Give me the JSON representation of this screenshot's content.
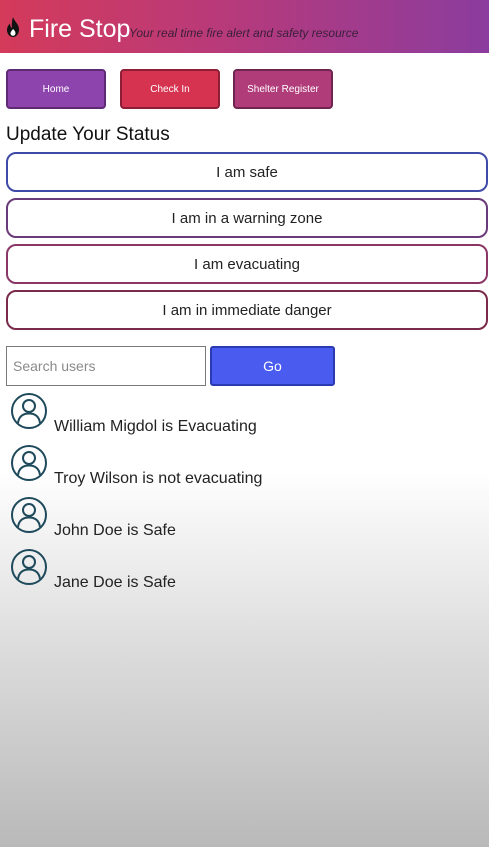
{
  "header": {
    "title": "Fire Stop",
    "tagline": "Your real time fire alert and safety resource",
    "logo_icon": "flame-icon",
    "colors": {
      "gradient_start": "#d43a5a",
      "gradient_end": "#8b3c9e"
    }
  },
  "nav": {
    "home": "Home",
    "check_in": "Check In",
    "shelter_register": "Shelter Register"
  },
  "status": {
    "heading": "Update Your Status",
    "options": [
      "I am safe",
      "I am in a warning zone",
      "I am evacuating",
      "I am in immediate danger"
    ]
  },
  "search": {
    "placeholder": "Search users",
    "value": "",
    "button": "Go"
  },
  "users": [
    {
      "text": "William Migdol is Evacuating",
      "icon": "user-avatar-icon"
    },
    {
      "text": "Troy Wilson is not evacuating",
      "icon": "user-avatar-icon"
    },
    {
      "text": "John Doe is Safe",
      "icon": "user-avatar-icon"
    },
    {
      "text": "Jane Doe is Safe",
      "icon": "user-avatar-icon"
    }
  ]
}
